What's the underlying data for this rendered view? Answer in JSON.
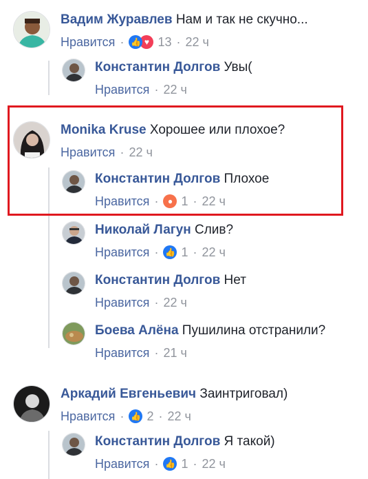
{
  "comments": [
    {
      "author": "Вадим Журавлев",
      "text": "Нам и так не скучно...",
      "like": "Нравится",
      "count": "13",
      "time": "22 ч",
      "reactions": [
        "like",
        "love"
      ]
    },
    {
      "author": "Константин Долгов",
      "text": "Увы(",
      "like": "Нравится",
      "count": "",
      "time": "22 ч",
      "reactions": []
    },
    {
      "author": "Monika Kruse",
      "text": "Хорошее или плохое?",
      "like": "Нравится",
      "count": "",
      "time": "22 ч",
      "reactions": []
    },
    {
      "author": "Константин Долгов",
      "text": "Плохое",
      "like": "Нравится",
      "count": "1",
      "time": "22 ч",
      "reactions": [
        "angry"
      ]
    },
    {
      "author": "Николай Лагун",
      "text": "Слив?",
      "like": "Нравится",
      "count": "1",
      "time": "22 ч",
      "reactions": [
        "like"
      ]
    },
    {
      "author": "Константин Долгов",
      "text": "Нет",
      "like": "Нравится",
      "count": "",
      "time": "22 ч",
      "reactions": []
    },
    {
      "author": "Боева Алёна",
      "text": "Пушилина отстранили?",
      "like": "Нравится",
      "count": "",
      "time": "21 ч",
      "reactions": []
    },
    {
      "author": "Аркадий Евгеньевич",
      "text": "Заинтриговал)",
      "like": "Нравится",
      "count": "2",
      "time": "22 ч",
      "reactions": [
        "like"
      ]
    },
    {
      "author": "Константин Долгов",
      "text": "Я такой)",
      "like": "Нравится",
      "count": "1",
      "time": "22 ч",
      "reactions": [
        "like"
      ]
    }
  ],
  "colors": {
    "author": "#385898",
    "like_blue": "#4b67a1",
    "meta": "#90949c",
    "highlight": "#e0181f",
    "like_icon": "#2078f4",
    "love_icon": "#f33e58",
    "angry_icon": "#f7714b"
  }
}
